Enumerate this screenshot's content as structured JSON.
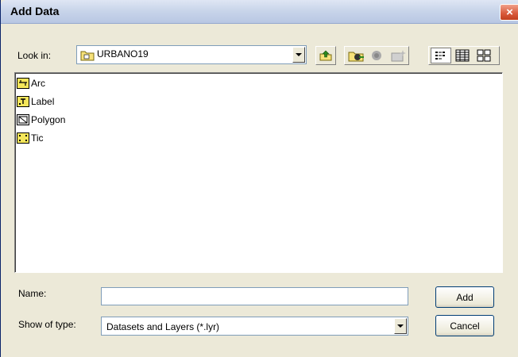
{
  "window": {
    "title": "Add Data",
    "close_label": "×"
  },
  "look_in": {
    "label": "Look in:",
    "value": "URBANO19"
  },
  "files": [
    {
      "name": "Arc",
      "icon": "arc-coverage-icon"
    },
    {
      "name": "Label",
      "icon": "label-coverage-icon"
    },
    {
      "name": "Polygon",
      "icon": "polygon-coverage-icon"
    },
    {
      "name": "Tic",
      "icon": "tic-coverage-icon"
    }
  ],
  "name_field": {
    "label": "Name:",
    "value": ""
  },
  "type_field": {
    "label": "Show of type:",
    "value": "Datasets and Layers (*.lyr)"
  },
  "buttons": {
    "add": "Add",
    "cancel": "Cancel"
  }
}
